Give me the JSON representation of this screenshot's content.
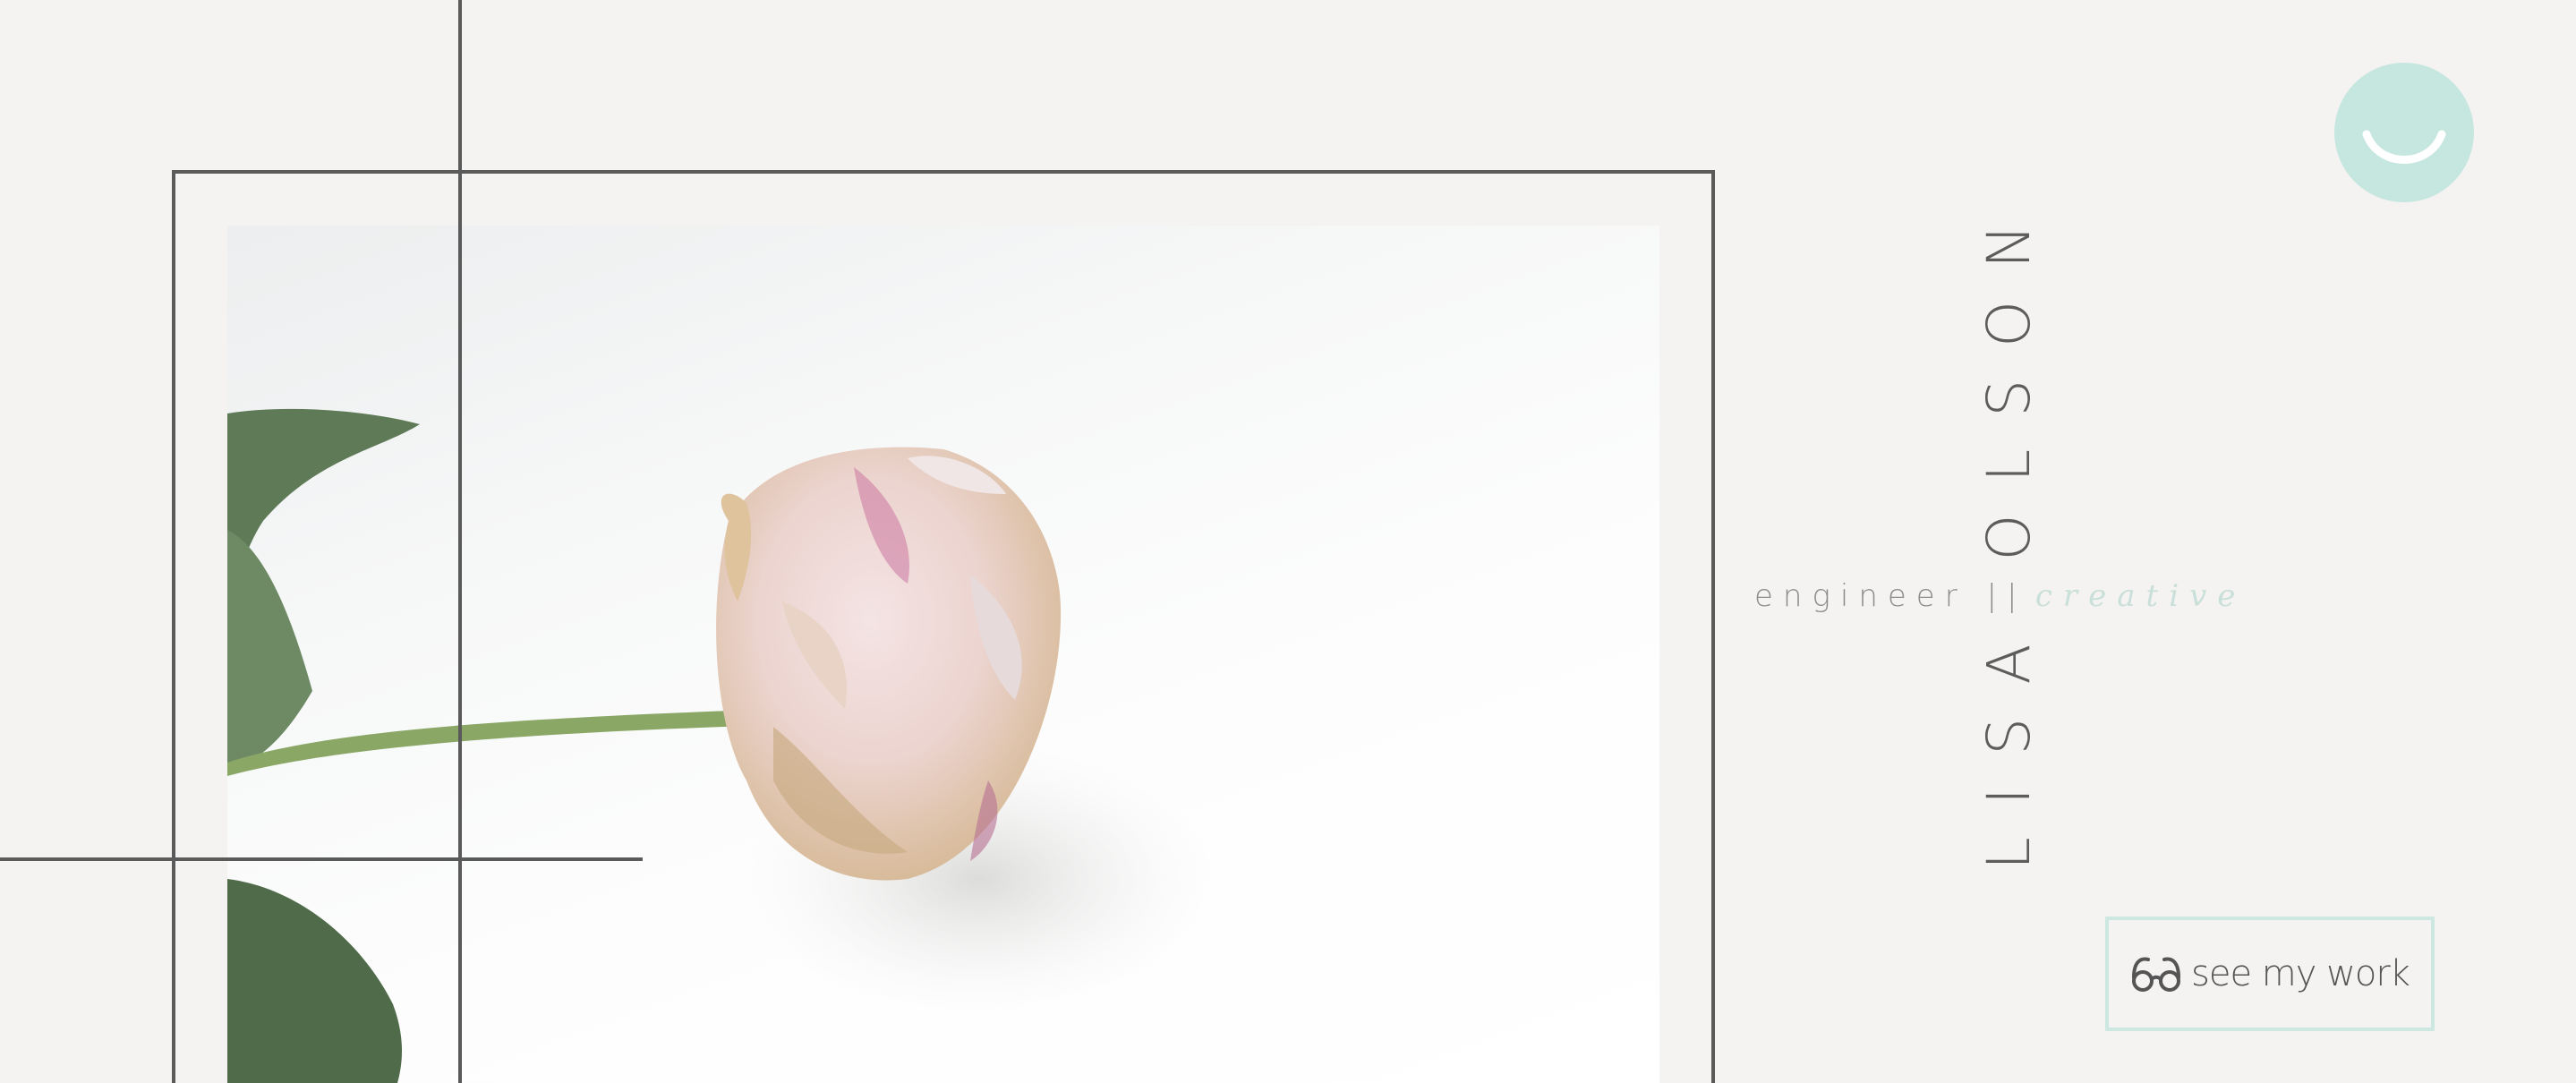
{
  "profile": {
    "name": "LISA OLSON",
    "tagline_primary": "engineer ||",
    "tagline_accent": "creative"
  },
  "actions": {
    "see_work_label": "see my work",
    "see_work_icon": "glasses-icon"
  },
  "branding": {
    "logo_icon": "smiley-icon"
  },
  "colors": {
    "background": "#f4f3f1",
    "line": "#5a5a5a",
    "accent_mint": "#c6e7df",
    "button_border": "#cde8e0",
    "text": "#5c5c5c"
  }
}
